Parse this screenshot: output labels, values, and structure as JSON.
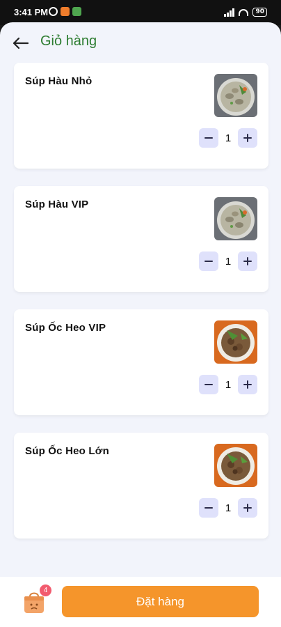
{
  "status_bar": {
    "time": "3:41 PM",
    "battery": "90"
  },
  "header": {
    "back_icon": "arrow-left-icon",
    "title": "Giỏ hàng"
  },
  "cart": {
    "items": [
      {
        "name": "Súp Hàu Nhỏ",
        "quantity": "1",
        "image": "oyster-soup"
      },
      {
        "name": "Súp Hàu VIP",
        "quantity": "1",
        "image": "oyster-soup"
      },
      {
        "name": "Súp Ốc Heo VIP",
        "quantity": "1",
        "image": "snail-pork-soup"
      },
      {
        "name": "Súp Ốc Heo Lớn",
        "quantity": "1",
        "image": "snail-pork-soup"
      }
    ]
  },
  "footer": {
    "cart_badge": "4",
    "order_button": "Đặt hàng"
  },
  "colors": {
    "title_green": "#2e7d32",
    "accent_orange": "#f5952b",
    "qty_button_bg": "#dfe1fb",
    "badge_red": "#f25b6e"
  }
}
